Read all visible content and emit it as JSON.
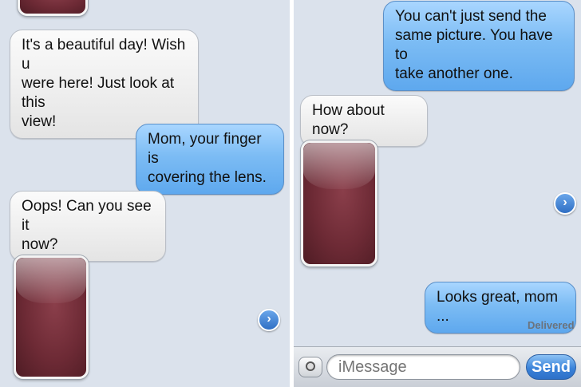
{
  "left": {
    "messages": [
      {
        "text": "It's a beautiful day! Wish u\nwere here! Just look at this\nview!"
      },
      {
        "text": "Mom, your finger is\ncovering the lens."
      },
      {
        "text": "Oops! Can you see it\nnow?"
      }
    ]
  },
  "right": {
    "messages": [
      {
        "text": "You can't just send the\nsame picture. You have to\ntake another one."
      },
      {
        "text": "How about now?"
      },
      {
        "text": "Looks great, mom ..."
      }
    ],
    "status": "Delivered",
    "composer": {
      "placeholder": "iMessage",
      "send_label": "Send"
    }
  },
  "colors": {
    "background": "#dbe2ec",
    "incoming_bubble": "#f0f0f0",
    "outgoing_bubble": "#7cbcf4",
    "photo": "#6d2a35",
    "send_button": "#3b83d9"
  },
  "icons": [
    "chevron-right-icon",
    "camera-icon"
  ]
}
